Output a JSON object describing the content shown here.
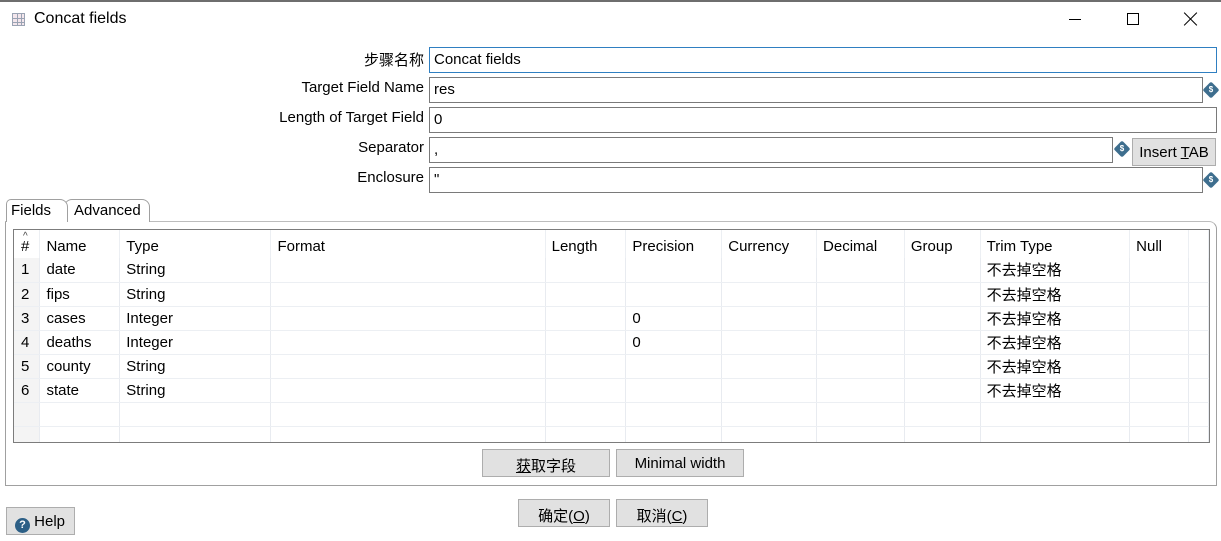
{
  "window": {
    "title": "Concat fields",
    "icon": "grid-icon",
    "controls": {
      "minimize": "minimize-icon",
      "maximize": "maximize-icon",
      "close": "close-icon"
    }
  },
  "form": {
    "step_name_label": "步骤名称",
    "step_name_value": "Concat fields",
    "target_field_label": "Target Field Name",
    "target_field_value": "res",
    "length_label": "Length of Target Field",
    "length_value": "0",
    "separator_label": "Separator",
    "separator_value": ",",
    "enclosure_label": "Enclosure",
    "enclosure_value": "\"",
    "insert_tab_button": {
      "prefix": "Insert ",
      "mnemonic": "T",
      "suffix": "AB"
    },
    "variable_icon_label": "$"
  },
  "tabs": [
    {
      "label": "Fields",
      "active": true
    },
    {
      "label": "Advanced",
      "active": false
    }
  ],
  "table": {
    "columns": [
      "#",
      "Name",
      "Type",
      "Format",
      "Length",
      "Precision",
      "Currency",
      "Decimal",
      "Group",
      "Trim Type",
      "Null"
    ],
    "rows": [
      [
        "1",
        "date",
        "String",
        "",
        "",
        "",
        "",
        "",
        "",
        "不去掉空格",
        ""
      ],
      [
        "2",
        "fips",
        "String",
        "",
        "",
        "",
        "",
        "",
        "",
        "不去掉空格",
        ""
      ],
      [
        "3",
        "cases",
        "Integer",
        "",
        "",
        "0",
        "",
        "",
        "",
        "不去掉空格",
        ""
      ],
      [
        "4",
        "deaths",
        "Integer",
        "",
        "",
        "0",
        "",
        "",
        "",
        "不去掉空格",
        ""
      ],
      [
        "5",
        "county",
        "String",
        "",
        "",
        "",
        "",
        "",
        "",
        "不去掉空格",
        ""
      ],
      [
        "6",
        "state",
        "String",
        "",
        "",
        "",
        "",
        "",
        "",
        "不去掉空格",
        ""
      ],
      [
        "",
        "",
        "",
        "",
        "",
        "",
        "",
        "",
        "",
        "",
        ""
      ],
      [
        "",
        "",
        "",
        "",
        "",
        "",
        "",
        "",
        "",
        "",
        ""
      ]
    ]
  },
  "buttons": {
    "get_fields": {
      "mnemonic": "获",
      "rest": "取字段"
    },
    "minimal_width": "Minimal width",
    "ok": {
      "prefix": "确定(",
      "mnemonic": "O",
      "suffix": ")"
    },
    "cancel": {
      "prefix": "取消(",
      "mnemonic": "C",
      "suffix": ")"
    },
    "help": "Help"
  }
}
